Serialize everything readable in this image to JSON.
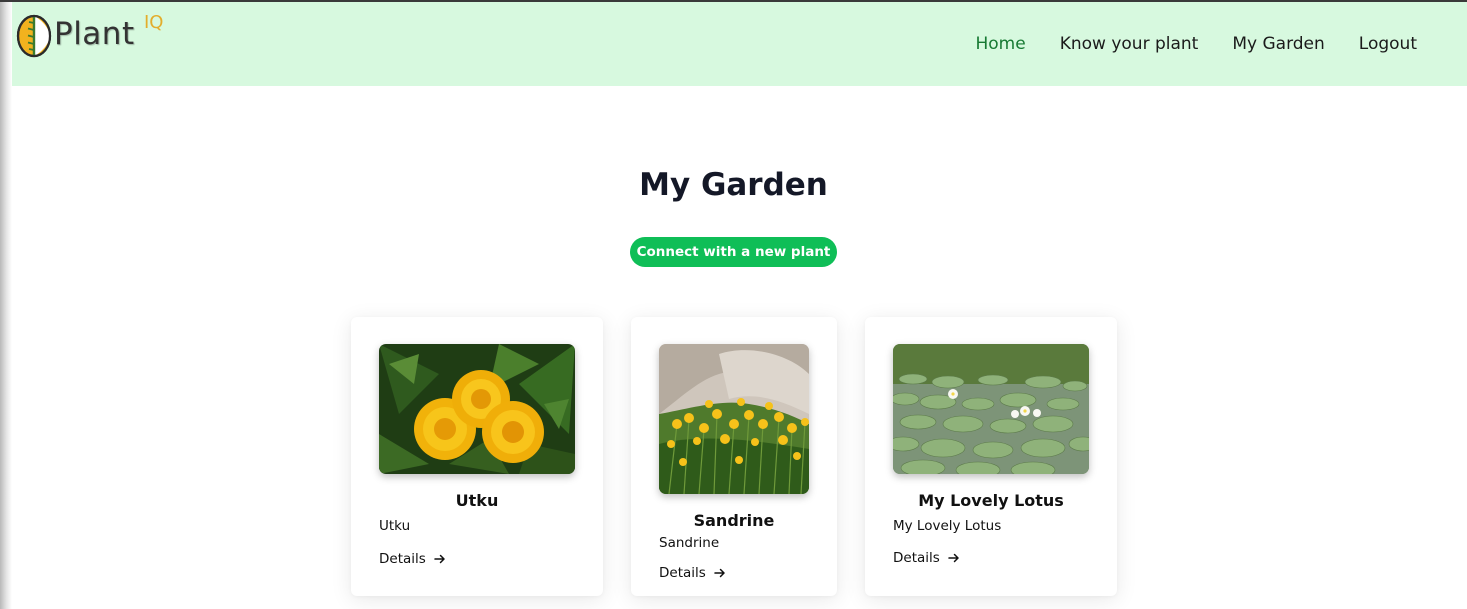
{
  "brand": {
    "name": "Plant",
    "superscript": "IQ",
    "logo_icon": "leaf-circle-logo-icon"
  },
  "nav": {
    "items": [
      {
        "label": "Home",
        "active": true
      },
      {
        "label": "Know your plant",
        "active": false
      },
      {
        "label": "My Garden",
        "active": false
      },
      {
        "label": "Logout",
        "active": false
      }
    ]
  },
  "main": {
    "title": "My Garden",
    "connect_button": "Connect with a new plant"
  },
  "cards": [
    {
      "title": "Utku",
      "subtitle": "Utku",
      "details_label": "Details",
      "details_icon": "arrow-right-icon",
      "image": "dandelion-photo"
    },
    {
      "title": "Sandrine",
      "subtitle": "Sandrine",
      "details_label": "Details",
      "details_icon": "arrow-right-icon",
      "image": "yellow-daffodils-photo"
    },
    {
      "title": "My Lovely Lotus",
      "subtitle": "My Lovely Lotus",
      "details_label": "Details",
      "details_icon": "arrow-right-icon",
      "image": "lotus-pond-photo"
    }
  ],
  "colors": {
    "navbar_bg": "#d7f9df",
    "active_nav": "#177a33",
    "button_green": "#0fbe57",
    "brand_accent": "#e3ad2c"
  }
}
